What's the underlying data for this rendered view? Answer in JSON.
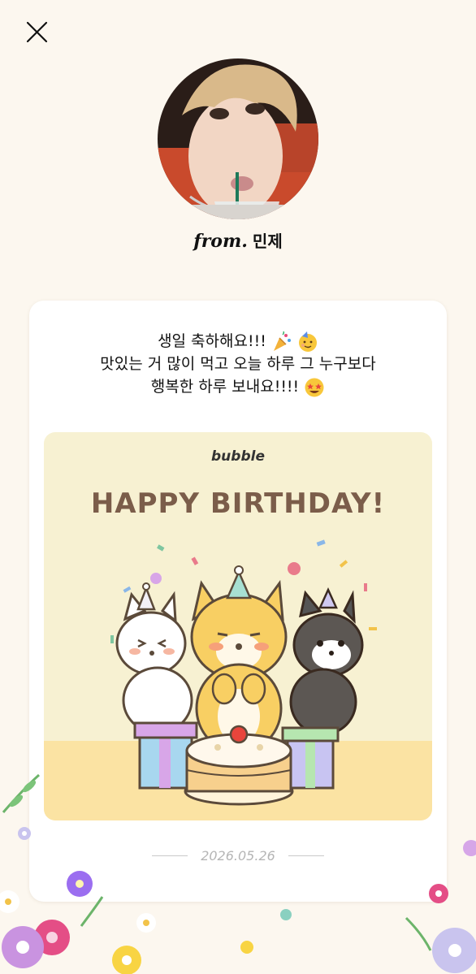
{
  "header": {
    "close_icon": "close-icon"
  },
  "sender": {
    "from_prefix": "from.",
    "name": "민제"
  },
  "letter": {
    "message_lines": [
      "생일 축하해요!!!",
      "맛있는 거 많이 먹고 오늘 하루 그 누구보다",
      "행복한 하루 보내요!!!!"
    ],
    "card": {
      "brand": "bubble",
      "headline": "HAPPY BIRTHDAY!"
    },
    "date": "2026.05.26"
  },
  "colors": {
    "background": "#fcf7ef",
    "card_bg": "#f7f1d2",
    "headline": "#7b5d4a",
    "date": "#b5b5b5"
  }
}
